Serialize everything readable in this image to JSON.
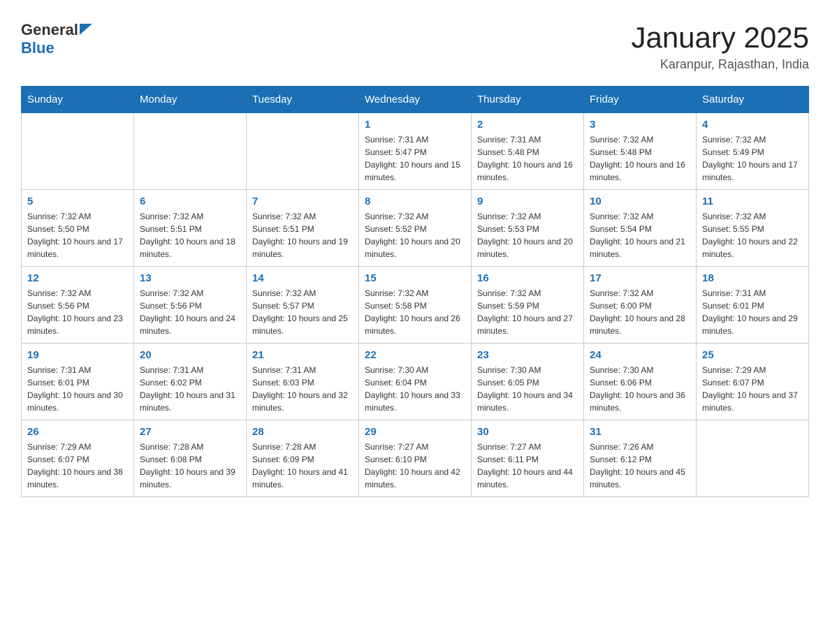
{
  "header": {
    "logo_general": "General",
    "logo_blue": "Blue",
    "title": "January 2025",
    "subtitle": "Karanpur, Rajasthan, India"
  },
  "days_of_week": [
    "Sunday",
    "Monday",
    "Tuesday",
    "Wednesday",
    "Thursday",
    "Friday",
    "Saturday"
  ],
  "weeks": [
    [
      {
        "day": "",
        "info": ""
      },
      {
        "day": "",
        "info": ""
      },
      {
        "day": "",
        "info": ""
      },
      {
        "day": "1",
        "info": "Sunrise: 7:31 AM\nSunset: 5:47 PM\nDaylight: 10 hours and 15 minutes."
      },
      {
        "day": "2",
        "info": "Sunrise: 7:31 AM\nSunset: 5:48 PM\nDaylight: 10 hours and 16 minutes."
      },
      {
        "day": "3",
        "info": "Sunrise: 7:32 AM\nSunset: 5:48 PM\nDaylight: 10 hours and 16 minutes."
      },
      {
        "day": "4",
        "info": "Sunrise: 7:32 AM\nSunset: 5:49 PM\nDaylight: 10 hours and 17 minutes."
      }
    ],
    [
      {
        "day": "5",
        "info": "Sunrise: 7:32 AM\nSunset: 5:50 PM\nDaylight: 10 hours and 17 minutes."
      },
      {
        "day": "6",
        "info": "Sunrise: 7:32 AM\nSunset: 5:51 PM\nDaylight: 10 hours and 18 minutes."
      },
      {
        "day": "7",
        "info": "Sunrise: 7:32 AM\nSunset: 5:51 PM\nDaylight: 10 hours and 19 minutes."
      },
      {
        "day": "8",
        "info": "Sunrise: 7:32 AM\nSunset: 5:52 PM\nDaylight: 10 hours and 20 minutes."
      },
      {
        "day": "9",
        "info": "Sunrise: 7:32 AM\nSunset: 5:53 PM\nDaylight: 10 hours and 20 minutes."
      },
      {
        "day": "10",
        "info": "Sunrise: 7:32 AM\nSunset: 5:54 PM\nDaylight: 10 hours and 21 minutes."
      },
      {
        "day": "11",
        "info": "Sunrise: 7:32 AM\nSunset: 5:55 PM\nDaylight: 10 hours and 22 minutes."
      }
    ],
    [
      {
        "day": "12",
        "info": "Sunrise: 7:32 AM\nSunset: 5:56 PM\nDaylight: 10 hours and 23 minutes."
      },
      {
        "day": "13",
        "info": "Sunrise: 7:32 AM\nSunset: 5:56 PM\nDaylight: 10 hours and 24 minutes."
      },
      {
        "day": "14",
        "info": "Sunrise: 7:32 AM\nSunset: 5:57 PM\nDaylight: 10 hours and 25 minutes."
      },
      {
        "day": "15",
        "info": "Sunrise: 7:32 AM\nSunset: 5:58 PM\nDaylight: 10 hours and 26 minutes."
      },
      {
        "day": "16",
        "info": "Sunrise: 7:32 AM\nSunset: 5:59 PM\nDaylight: 10 hours and 27 minutes."
      },
      {
        "day": "17",
        "info": "Sunrise: 7:32 AM\nSunset: 6:00 PM\nDaylight: 10 hours and 28 minutes."
      },
      {
        "day": "18",
        "info": "Sunrise: 7:31 AM\nSunset: 6:01 PM\nDaylight: 10 hours and 29 minutes."
      }
    ],
    [
      {
        "day": "19",
        "info": "Sunrise: 7:31 AM\nSunset: 6:01 PM\nDaylight: 10 hours and 30 minutes."
      },
      {
        "day": "20",
        "info": "Sunrise: 7:31 AM\nSunset: 6:02 PM\nDaylight: 10 hours and 31 minutes."
      },
      {
        "day": "21",
        "info": "Sunrise: 7:31 AM\nSunset: 6:03 PM\nDaylight: 10 hours and 32 minutes."
      },
      {
        "day": "22",
        "info": "Sunrise: 7:30 AM\nSunset: 6:04 PM\nDaylight: 10 hours and 33 minutes."
      },
      {
        "day": "23",
        "info": "Sunrise: 7:30 AM\nSunset: 6:05 PM\nDaylight: 10 hours and 34 minutes."
      },
      {
        "day": "24",
        "info": "Sunrise: 7:30 AM\nSunset: 6:06 PM\nDaylight: 10 hours and 36 minutes."
      },
      {
        "day": "25",
        "info": "Sunrise: 7:29 AM\nSunset: 6:07 PM\nDaylight: 10 hours and 37 minutes."
      }
    ],
    [
      {
        "day": "26",
        "info": "Sunrise: 7:29 AM\nSunset: 6:07 PM\nDaylight: 10 hours and 38 minutes."
      },
      {
        "day": "27",
        "info": "Sunrise: 7:28 AM\nSunset: 6:08 PM\nDaylight: 10 hours and 39 minutes."
      },
      {
        "day": "28",
        "info": "Sunrise: 7:28 AM\nSunset: 6:09 PM\nDaylight: 10 hours and 41 minutes."
      },
      {
        "day": "29",
        "info": "Sunrise: 7:27 AM\nSunset: 6:10 PM\nDaylight: 10 hours and 42 minutes."
      },
      {
        "day": "30",
        "info": "Sunrise: 7:27 AM\nSunset: 6:11 PM\nDaylight: 10 hours and 44 minutes."
      },
      {
        "day": "31",
        "info": "Sunrise: 7:26 AM\nSunset: 6:12 PM\nDaylight: 10 hours and 45 minutes."
      },
      {
        "day": "",
        "info": ""
      }
    ]
  ]
}
